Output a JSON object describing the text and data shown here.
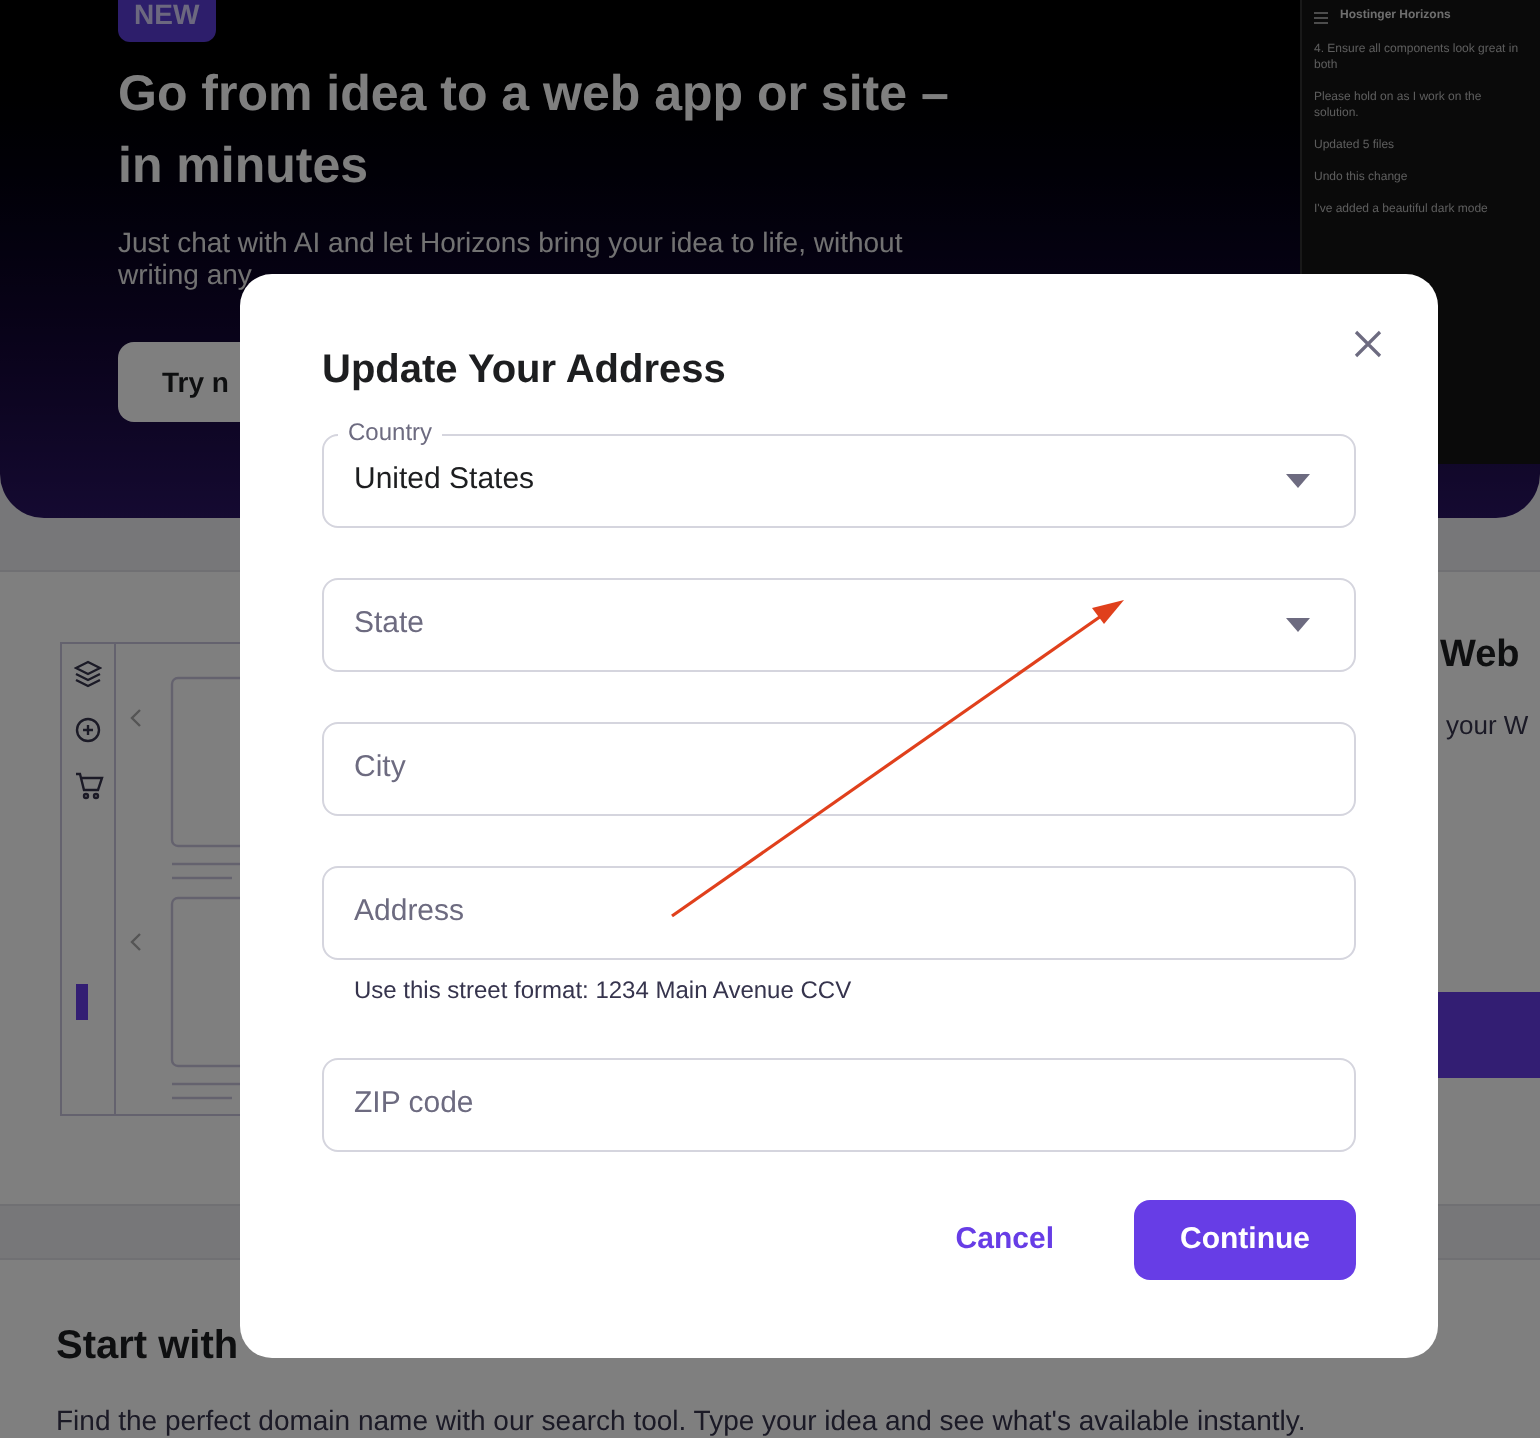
{
  "hero": {
    "badge": "NEW",
    "heading": "Go from idea to a web app or site – in minutes",
    "text": "Just chat with AI and let Horizons bring your idea to life, without writing any",
    "button": "Try n"
  },
  "chat_panel": {
    "title": "Hostinger Horizons",
    "lines": [
      "4. Ensure all components look great in both",
      "Please hold on as I work on the solution.",
      "Updated 5 files",
      "Undo this change",
      "I've added a beautiful dark mode"
    ]
  },
  "builder_section": {
    "heading": "Web",
    "text": "your W"
  },
  "domain_section": {
    "heading": "Start with",
    "text": "Find the perfect domain name with our search tool. Type your idea and see what's available instantly."
  },
  "dialog": {
    "title": "Update Your Address",
    "fields": [
      {
        "kind": "select",
        "label": "Country",
        "value": "United States"
      },
      {
        "kind": "select",
        "placeholder": "State"
      },
      {
        "kind": "text",
        "placeholder": "City"
      },
      {
        "kind": "text",
        "placeholder": "Address",
        "hint": "Use this street format: 1234 Main Avenue CCV"
      },
      {
        "kind": "text",
        "placeholder": "ZIP code"
      }
    ],
    "cancel": "Cancel",
    "continue": "Continue"
  }
}
